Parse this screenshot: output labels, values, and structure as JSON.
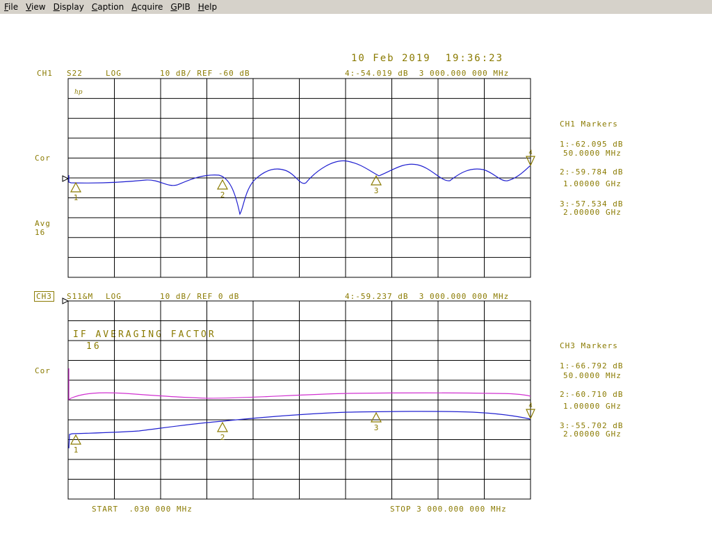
{
  "menu": [
    {
      "m": "F",
      "r": "ile"
    },
    {
      "m": "V",
      "r": "iew"
    },
    {
      "m": "D",
      "r": "isplay"
    },
    {
      "m": "C",
      "r": "aption"
    },
    {
      "m": "A",
      "r": "cquire"
    },
    {
      "m": "G",
      "r": "PIB"
    },
    {
      "m": "H",
      "r": "elp"
    }
  ],
  "date": "10 Feb 2019  19:36:23",
  "ch1": {
    "label": "CH1",
    "param": "S22",
    "format": "LOG",
    "scale": "10 dB/ REF -60 dB",
    "marker4": "4:-54.019 dB  3 000.000 000 MHz",
    "cor": "Cor",
    "avg": "Avg",
    "avg_factor": "16",
    "hp": "hp",
    "markers_title": "CH1 Markers",
    "markers": [
      {
        "value": "1:-62.095 dB",
        "freq": "50.0000 MHz"
      },
      {
        "value": "2:-59.784 dB",
        "freq": "1.00000 GHz"
      },
      {
        "value": "3:-57.534 dB",
        "freq": "2.00000 GHz"
      }
    ],
    "marker_nums": [
      "1",
      "2",
      "3",
      "4"
    ]
  },
  "ch3": {
    "label": "CH3",
    "param": "S11&M",
    "format": "LOG",
    "scale": "10 dB/ REF 0 dB",
    "marker4": "4:-59.237 dB  3 000.000 000 MHz",
    "cor": "Cor",
    "if_avg": "IF AVERAGING FACTOR",
    "if_avg_value": "16",
    "markers_title": "CH3 Markers",
    "markers": [
      {
        "value": "1:-66.792 dB",
        "freq": "50.0000 MHz"
      },
      {
        "value": "2:-60.710 dB",
        "freq": "1.00000 GHz"
      },
      {
        "value": "3:-55.702 dB",
        "freq": "2.00000 GHz"
      }
    ],
    "marker_nums": [
      "1",
      "2",
      "3",
      "4"
    ]
  },
  "start": "START  .030 000 MHz",
  "stop": "STOP 3 000.000 000 MHz",
  "colors": {
    "grid": "#000000",
    "annotation": "#8a7a00",
    "trace": "#2020d0",
    "memory": "#d030d0"
  },
  "chart_data": [
    {
      "type": "line",
      "title": "CH1 S22 LOG 10 dB/ REF -60 dB",
      "xlabel": "",
      "ylabel": "",
      "xlim": [
        3e-05,
        3000
      ],
      "ylim": [
        -110,
        -10
      ],
      "series": [
        {
          "name": "S22",
          "x": [
            0.03,
            50,
            300,
            500,
            750,
            1000,
            1150,
            1300,
            1500,
            1800,
            2000,
            2250,
            2500,
            2750,
            3000
          ],
          "y": [
            -60,
            -62,
            -60,
            -63,
            -60,
            -60,
            -79,
            -55,
            -62,
            -54,
            -60,
            -55,
            -61,
            -55,
            -54
          ]
        }
      ]
    },
    {
      "type": "line",
      "title": "CH3 S11&M LOG 10 dB/ REF 0 dB",
      "xlabel": "",
      "ylabel": "",
      "xlim": [
        3e-05,
        3000
      ],
      "ylim": [
        -100,
        0
      ],
      "series": [
        {
          "name": "S11",
          "x": [
            0.03,
            50,
            1000,
            2000,
            3000
          ],
          "y": [
            -69,
            -67,
            -61,
            -56,
            -59
          ]
        },
        {
          "name": "M",
          "x": [
            0.03,
            50,
            250,
            1000,
            2000,
            2900,
            3000
          ],
          "y": [
            -49,
            -48,
            -46,
            -49,
            -47,
            -47,
            -48
          ]
        }
      ]
    }
  ]
}
